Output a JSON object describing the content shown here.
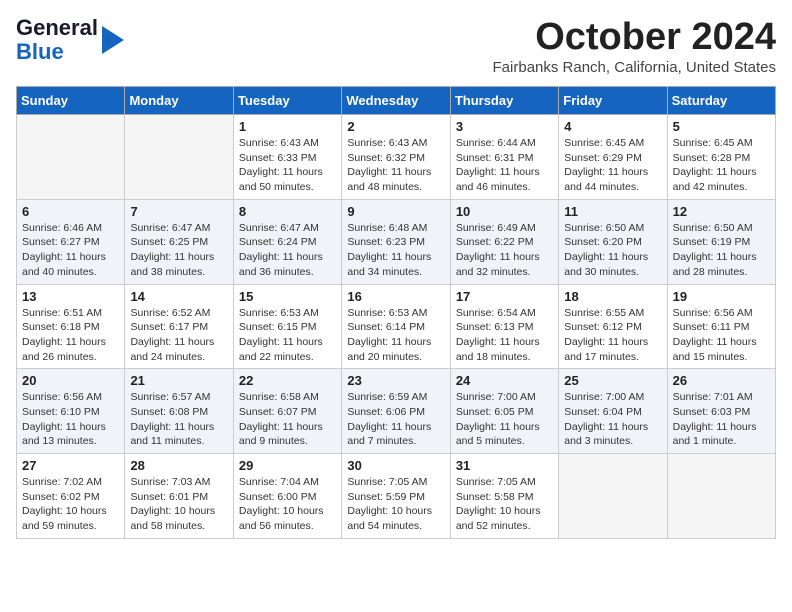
{
  "logo": {
    "line1": "General",
    "line2": "Blue",
    "arrow": true
  },
  "title": "October 2024",
  "location": "Fairbanks Ranch, California, United States",
  "weekdays": [
    "Sunday",
    "Monday",
    "Tuesday",
    "Wednesday",
    "Thursday",
    "Friday",
    "Saturday"
  ],
  "weeks": [
    [
      {
        "day": "",
        "content": ""
      },
      {
        "day": "",
        "content": ""
      },
      {
        "day": "1",
        "content": "Sunrise: 6:43 AM\nSunset: 6:33 PM\nDaylight: 11 hours and 50 minutes."
      },
      {
        "day": "2",
        "content": "Sunrise: 6:43 AM\nSunset: 6:32 PM\nDaylight: 11 hours and 48 minutes."
      },
      {
        "day": "3",
        "content": "Sunrise: 6:44 AM\nSunset: 6:31 PM\nDaylight: 11 hours and 46 minutes."
      },
      {
        "day": "4",
        "content": "Sunrise: 6:45 AM\nSunset: 6:29 PM\nDaylight: 11 hours and 44 minutes."
      },
      {
        "day": "5",
        "content": "Sunrise: 6:45 AM\nSunset: 6:28 PM\nDaylight: 11 hours and 42 minutes."
      }
    ],
    [
      {
        "day": "6",
        "content": "Sunrise: 6:46 AM\nSunset: 6:27 PM\nDaylight: 11 hours and 40 minutes."
      },
      {
        "day": "7",
        "content": "Sunrise: 6:47 AM\nSunset: 6:25 PM\nDaylight: 11 hours and 38 minutes."
      },
      {
        "day": "8",
        "content": "Sunrise: 6:47 AM\nSunset: 6:24 PM\nDaylight: 11 hours and 36 minutes."
      },
      {
        "day": "9",
        "content": "Sunrise: 6:48 AM\nSunset: 6:23 PM\nDaylight: 11 hours and 34 minutes."
      },
      {
        "day": "10",
        "content": "Sunrise: 6:49 AM\nSunset: 6:22 PM\nDaylight: 11 hours and 32 minutes."
      },
      {
        "day": "11",
        "content": "Sunrise: 6:50 AM\nSunset: 6:20 PM\nDaylight: 11 hours and 30 minutes."
      },
      {
        "day": "12",
        "content": "Sunrise: 6:50 AM\nSunset: 6:19 PM\nDaylight: 11 hours and 28 minutes."
      }
    ],
    [
      {
        "day": "13",
        "content": "Sunrise: 6:51 AM\nSunset: 6:18 PM\nDaylight: 11 hours and 26 minutes."
      },
      {
        "day": "14",
        "content": "Sunrise: 6:52 AM\nSunset: 6:17 PM\nDaylight: 11 hours and 24 minutes."
      },
      {
        "day": "15",
        "content": "Sunrise: 6:53 AM\nSunset: 6:15 PM\nDaylight: 11 hours and 22 minutes."
      },
      {
        "day": "16",
        "content": "Sunrise: 6:53 AM\nSunset: 6:14 PM\nDaylight: 11 hours and 20 minutes."
      },
      {
        "day": "17",
        "content": "Sunrise: 6:54 AM\nSunset: 6:13 PM\nDaylight: 11 hours and 18 minutes."
      },
      {
        "day": "18",
        "content": "Sunrise: 6:55 AM\nSunset: 6:12 PM\nDaylight: 11 hours and 17 minutes."
      },
      {
        "day": "19",
        "content": "Sunrise: 6:56 AM\nSunset: 6:11 PM\nDaylight: 11 hours and 15 minutes."
      }
    ],
    [
      {
        "day": "20",
        "content": "Sunrise: 6:56 AM\nSunset: 6:10 PM\nDaylight: 11 hours and 13 minutes."
      },
      {
        "day": "21",
        "content": "Sunrise: 6:57 AM\nSunset: 6:08 PM\nDaylight: 11 hours and 11 minutes."
      },
      {
        "day": "22",
        "content": "Sunrise: 6:58 AM\nSunset: 6:07 PM\nDaylight: 11 hours and 9 minutes."
      },
      {
        "day": "23",
        "content": "Sunrise: 6:59 AM\nSunset: 6:06 PM\nDaylight: 11 hours and 7 minutes."
      },
      {
        "day": "24",
        "content": "Sunrise: 7:00 AM\nSunset: 6:05 PM\nDaylight: 11 hours and 5 minutes."
      },
      {
        "day": "25",
        "content": "Sunrise: 7:00 AM\nSunset: 6:04 PM\nDaylight: 11 hours and 3 minutes."
      },
      {
        "day": "26",
        "content": "Sunrise: 7:01 AM\nSunset: 6:03 PM\nDaylight: 11 hours and 1 minute."
      }
    ],
    [
      {
        "day": "27",
        "content": "Sunrise: 7:02 AM\nSunset: 6:02 PM\nDaylight: 10 hours and 59 minutes."
      },
      {
        "day": "28",
        "content": "Sunrise: 7:03 AM\nSunset: 6:01 PM\nDaylight: 10 hours and 58 minutes."
      },
      {
        "day": "29",
        "content": "Sunrise: 7:04 AM\nSunset: 6:00 PM\nDaylight: 10 hours and 56 minutes."
      },
      {
        "day": "30",
        "content": "Sunrise: 7:05 AM\nSunset: 5:59 PM\nDaylight: 10 hours and 54 minutes."
      },
      {
        "day": "31",
        "content": "Sunrise: 7:05 AM\nSunset: 5:58 PM\nDaylight: 10 hours and 52 minutes."
      },
      {
        "day": "",
        "content": ""
      },
      {
        "day": "",
        "content": ""
      }
    ]
  ]
}
